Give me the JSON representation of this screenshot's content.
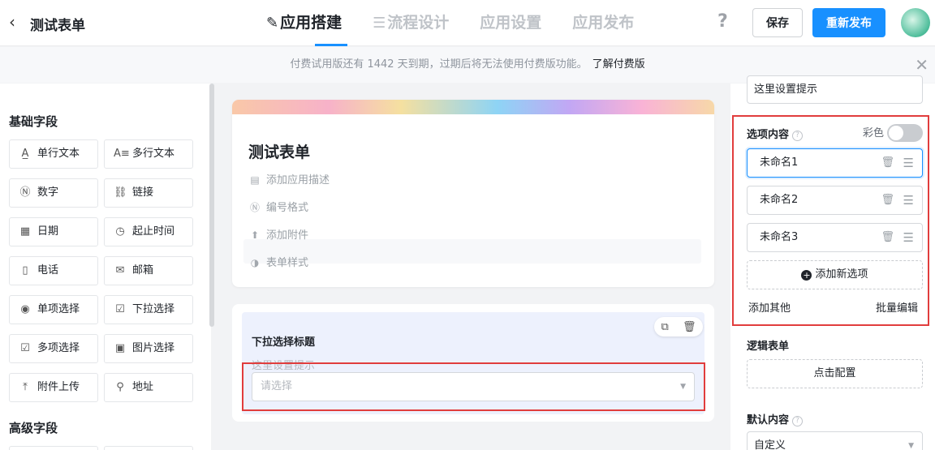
{
  "header": {
    "back_icon": "chevron-left-icon",
    "app_title": "测试表单",
    "tabs": [
      {
        "icon": "✎",
        "label": "应用搭建"
      },
      {
        "icon": "☰",
        "label": "流程设计"
      },
      {
        "label": "应用设置"
      },
      {
        "label": "应用发布"
      }
    ],
    "help_label": "?",
    "save_label": "保存",
    "publish_label": "重新发布",
    "accent_color": "#1890ff"
  },
  "notice": {
    "text": "付费试用版还有 1442 天到期，过期后将无法使用付费版功能。",
    "link": "了解付费版",
    "close": "✕"
  },
  "left_panel": {
    "basic_title": "基础字段",
    "advanced_title": "高级字段",
    "fields": [
      {
        "icon": "A̲",
        "label": "单行文本"
      },
      {
        "icon": "A≡",
        "label": "多行文本"
      },
      {
        "icon": "Ⓝ",
        "label": "数字"
      },
      {
        "icon": "⛓",
        "label": "链接"
      },
      {
        "icon": "▦",
        "label": "日期"
      },
      {
        "icon": "◷",
        "label": "起止时间"
      },
      {
        "icon": "▯",
        "label": "电话"
      },
      {
        "icon": "✉",
        "label": "邮箱"
      },
      {
        "icon": "◉",
        "label": "单项选择"
      },
      {
        "icon": "☑",
        "label": "下拉选择"
      },
      {
        "icon": "☑",
        "label": "多项选择"
      },
      {
        "icon": "▣",
        "label": "图片选择"
      },
      {
        "icon": "⤒",
        "label": "附件上传"
      },
      {
        "icon": "⚲",
        "label": "地址"
      }
    ]
  },
  "form_card": {
    "title": "测试表单",
    "meta": [
      {
        "icon": "▤",
        "label": "添加应用描述"
      },
      {
        "icon": "Ⓝ",
        "label": "编号格式"
      },
      {
        "icon": "⬆",
        "label": "添加附件"
      },
      {
        "icon": "◑",
        "label": "表单样式"
      }
    ]
  },
  "field_card": {
    "title": "下拉选择标题",
    "hint": "这里设置提示",
    "placeholder": "请选择",
    "copy_icon": "⧉",
    "delete_icon": "🗑"
  },
  "right_panel": {
    "hint_value": "这里设置提示",
    "options_title": "选项内容",
    "color_label": "彩色",
    "color_enabled": false,
    "options": [
      "未命名1",
      "未命名2",
      "未命名3"
    ],
    "add_option": "添加新选项",
    "add_other": "添加其他",
    "batch_edit": "批量编辑",
    "logic_title": "逻辑表单",
    "configure": "点击配置",
    "default_title": "默认内容",
    "default_value": "自定义"
  }
}
